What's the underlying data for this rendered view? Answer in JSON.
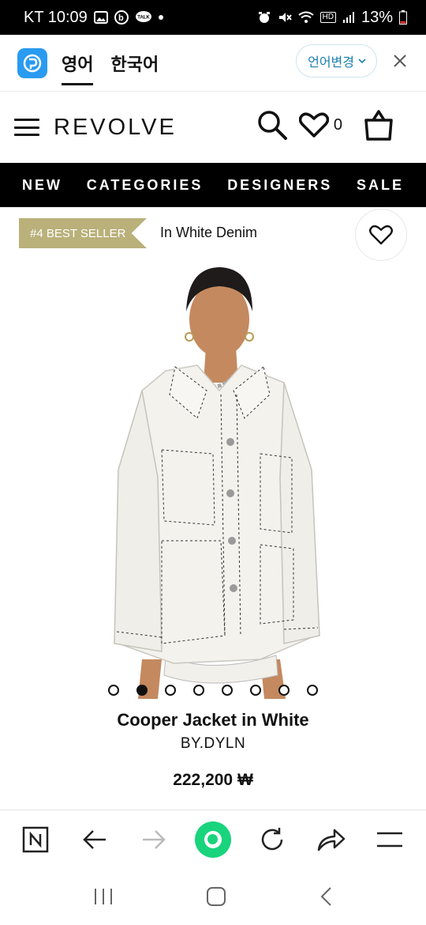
{
  "status_bar": {
    "carrier_time": "KT 10:09",
    "talk_badge": "TALK",
    "hd_badge": "HD",
    "battery": "13%"
  },
  "translate_bar": {
    "source_lang": "영어",
    "target_lang": "한국어",
    "change_label": "언어변경"
  },
  "header": {
    "logo": "REVOLVE",
    "wishlist_count": "0"
  },
  "nav": {
    "items": [
      "NEW",
      "CATEGORIES",
      "DESIGNERS",
      "SALE"
    ]
  },
  "product": {
    "badge": "#4 BEST SELLER",
    "color": "In White Denim",
    "title": "Cooper Jacket in White",
    "brand": "BY.DYLN",
    "price": "222,200 ₩",
    "image_index": 2,
    "image_count": 8
  },
  "colors": {
    "papago_blue": "#2a9bf0",
    "badge_gold": "#b9b07a",
    "green": "#19d47d",
    "lang_blue": "#1a7fb0"
  },
  "icons": [
    "papago-icon",
    "chevron-down-icon",
    "close-icon",
    "menu-icon",
    "search-icon",
    "heart-icon",
    "bag-icon",
    "n-home-icon",
    "back-icon",
    "forward-icon",
    "green-dot-icon",
    "refresh-icon",
    "share-icon",
    "more-menu-icon",
    "recents-icon",
    "home-icon"
  ]
}
